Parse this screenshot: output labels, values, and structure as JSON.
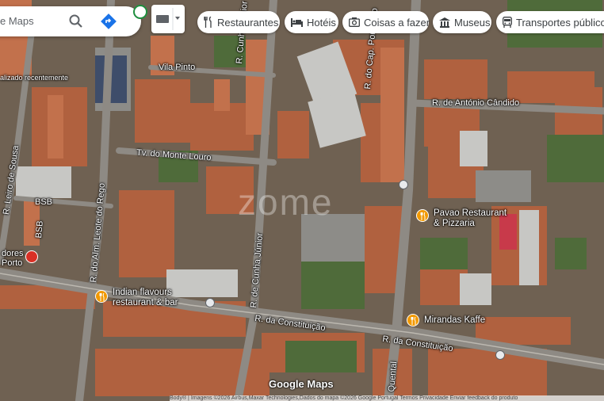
{
  "search": {
    "query": "e Maps"
  },
  "chips": [
    {
      "label": "Restaurantes",
      "icon": "fork-knife-icon"
    },
    {
      "label": "Hotéis",
      "icon": "bed-icon"
    },
    {
      "label": "Coisas a fazer",
      "icon": "camera-icon"
    },
    {
      "label": "Museus",
      "icon": "museum-icon"
    },
    {
      "label": "Transportes públicos",
      "icon": "transit-icon"
    }
  ],
  "recent_label": "alizado recentemente",
  "streets": {
    "vila_pinto": "Vila Pinto",
    "cunha_junior_top": "R. Cunha Júnior",
    "cap_pombeiro": "R. do Cap. Pombeiro",
    "antonio_candido": "R. de António Cândido",
    "monte_louro": "Tv. do Monte Louro",
    "alm_leote": "R. do Alm. Leote do Rego",
    "cunha_junior_bottom": "R. de Cunha Júnior",
    "bsb_1": "BSB",
    "bsb_2": "BSB",
    "sousa": "R. Leiro de Sousa",
    "constituicao_1": "R. da Constituição",
    "constituicao_2": "R. da Constituição",
    "quental": "Quental",
    "dores": "dores",
    "porto": "Porto"
  },
  "pois": {
    "pavao": "Pavao Restaurant\n& Pizzaria",
    "indian": "Indian flavours\nrestaurant & bar",
    "mirandas": "Mirandas Kaffe"
  },
  "brand": "Google Maps",
  "watermark": "zome",
  "attribution": "Body® | Imagens ©2026 Airbus,Maxar Technologies,Dados do mapa ©2026 Google    Portugal    Termos    Privacidade    Enviar feedback do produto"
}
